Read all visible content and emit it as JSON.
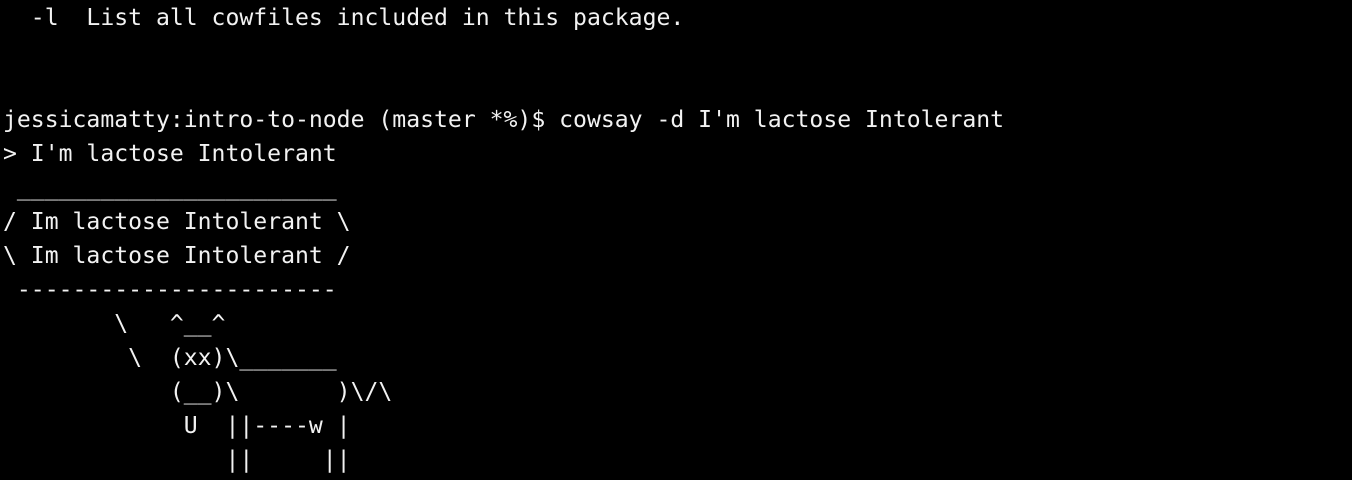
{
  "terminal": {
    "colors": {
      "background": "#000000",
      "text": "#f2f2f2"
    },
    "lines": [
      "  -l  List all cowfiles included in this package.",
      "",
      "",
      "jessicamatty:intro-to-node (master *%)$ cowsay -d I'm lactose Intolerant",
      "> I'm lactose Intolerant",
      " _______________________",
      "/ Im lactose Intolerant \\",
      "\\ Im lactose Intolerant /",
      " -----------------------",
      "        \\   ^__^",
      "         \\  (xx)\\_______",
      "            (__)\\       )\\/\\",
      "             U  ||----w |",
      "                ||     ||"
    ]
  }
}
